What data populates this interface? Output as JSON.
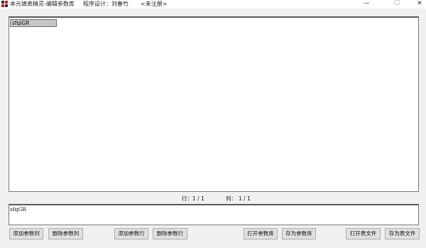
{
  "titlebar": {
    "app_title": "本元填表精灵-编辑参数库",
    "designer": "程序设计：刘春竹",
    "registration": "<未注册>",
    "minimize_glyph": "—",
    "maximize_glyph": "☐",
    "close_glyph": "✕"
  },
  "grid": {
    "cell_value": "sfqiGR"
  },
  "status": {
    "row_label": "行：",
    "row_value": "1 / 1",
    "col_label": "列：",
    "col_value": "1 / 1"
  },
  "editor": {
    "text": "sfqGR"
  },
  "buttons": {
    "add_column": "添加参数列",
    "delete_column": "删除参数列",
    "add_row": "添加参数行",
    "delete_row": "删除参数行",
    "open_library": "打开参数库",
    "save_library": "存为参数库",
    "open_sheet": "打开表文件",
    "save_sheet": "存为表文件"
  },
  "colors": {
    "icon_dark": "#2b2b2b",
    "icon_red": "#b22222",
    "window_bg": "#f0f0f0",
    "button_bg": "#e1e1e1",
    "selected_cell_bg": "#c7c7c7"
  }
}
